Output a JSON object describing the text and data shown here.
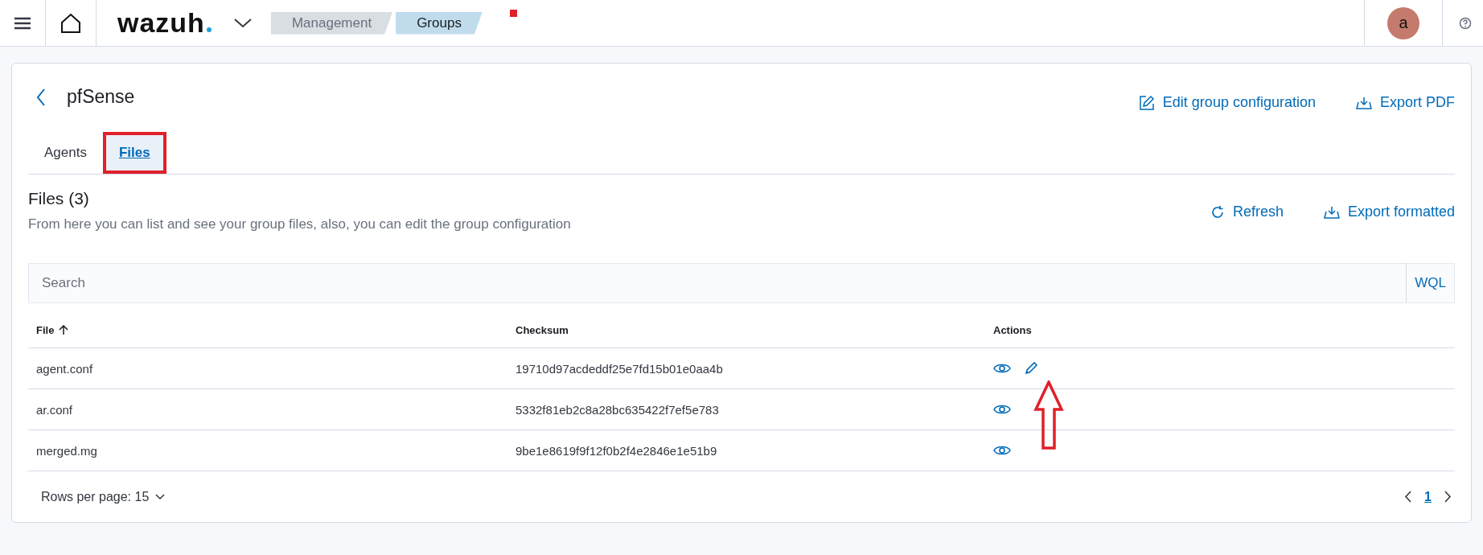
{
  "top_bar": {
    "logo": "wazuh",
    "breadcrumbs": [
      {
        "label": "Management",
        "selected": false
      },
      {
        "label": "Groups",
        "selected": true
      }
    ],
    "avatar": "a"
  },
  "group": {
    "title": "pfSense",
    "actions": [
      "Edit group configuration",
      "Export PDF"
    ]
  },
  "tabs": [
    {
      "label": "Agents",
      "selected": false,
      "highlighted": false
    },
    {
      "label": "Files",
      "selected": true,
      "highlighted": true
    }
  ],
  "files": {
    "title": "Files (3)",
    "description": "From here you can list and see your group files, also, you can edit the group configuration",
    "actions": [
      "Refresh",
      "Export formatted"
    ]
  },
  "search": {
    "placeholder": "Search",
    "language": "WQL"
  },
  "table": {
    "columns": [
      "File",
      "Checksum",
      "Actions"
    ],
    "rows": [
      {
        "file": "agent.conf",
        "checksum": "19710d97acdeddf25e7fd15b01e0aa4b",
        "editable": true,
        "pointed": true
      },
      {
        "file": "ar.conf",
        "checksum": "5332f81eb2c8a28bc635422f7ef5e783",
        "editable": false,
        "pointed": false
      },
      {
        "file": "merged.mg",
        "checksum": "9be1e8619f9f12f0b2f4e2846e1e51b9",
        "editable": false,
        "pointed": false
      }
    ]
  },
  "pagination": {
    "rows_per_page": "Rows per page: 15",
    "pages": [
      {
        "label": "1",
        "selected": true
      }
    ]
  }
}
